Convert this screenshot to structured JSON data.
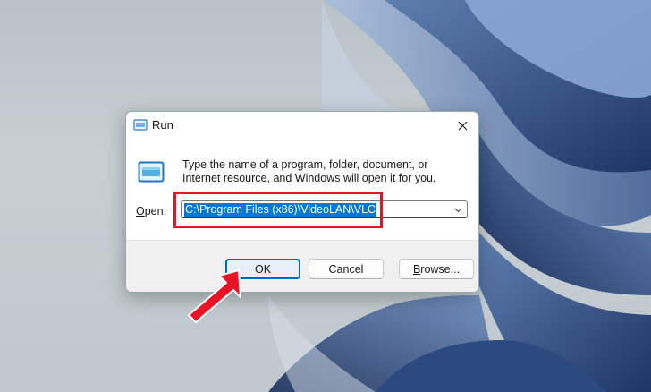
{
  "dialog": {
    "title": "Run",
    "message": "Type the name of a program, folder, document, or Internet resource, and Windows will open it for you.",
    "open_label_accel": "O",
    "open_label_rest": "pen:",
    "open_value": "C:\\Program Files (x86)\\VideoLAN\\VLC"
  },
  "buttons": {
    "ok_label": "OK",
    "cancel_label": "Cancel",
    "browse_accel": "B",
    "browse_rest": "rowse..."
  },
  "icons": {
    "title": "run-app-icon",
    "main": "run-app-icon",
    "close": "close-icon",
    "dropdown": "chevron-down-icon",
    "annotation": "pointer-arrow-icon"
  },
  "colors": {
    "selection": "#0078d4",
    "annotation": "#e81324",
    "ok_border": "#0067c0"
  }
}
